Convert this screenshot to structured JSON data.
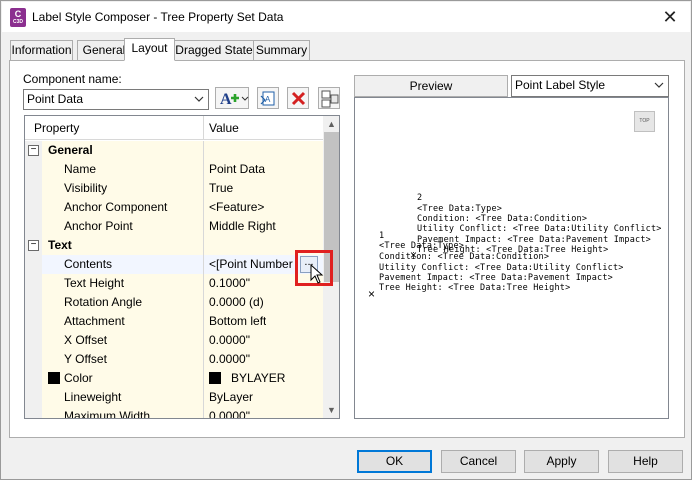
{
  "window": {
    "app_icon_text": "C",
    "app_icon_subtext": "C3D",
    "title": "Label Style Composer - Tree Property Set Data",
    "close_glyph": "✕"
  },
  "tabs": [
    {
      "label": "Information",
      "active": false
    },
    {
      "label": "General",
      "active": false
    },
    {
      "label": "Layout",
      "active": true
    },
    {
      "label": "Dragged State",
      "active": false
    },
    {
      "label": "Summary",
      "active": false
    }
  ],
  "component": {
    "label": "Component name:",
    "value": "Point Data"
  },
  "toolbar": {
    "add_icon": "add-component-icon",
    "copy_icon": "copy-component-icon",
    "delete_icon": "delete-component-icon",
    "order_icon": "component-draw-order-icon"
  },
  "grid": {
    "col_property": "Property",
    "col_value": "Value",
    "rows": [
      {
        "type": "category",
        "name": "General",
        "toggle": "−"
      },
      {
        "type": "prop",
        "name": "Name",
        "value": "Point Data"
      },
      {
        "type": "prop",
        "name": "Visibility",
        "value": "True"
      },
      {
        "type": "prop",
        "name": "Anchor Component",
        "value": "<Feature>"
      },
      {
        "type": "prop",
        "name": "Anchor Point",
        "value": "Middle Right"
      },
      {
        "type": "category",
        "name": "Text",
        "toggle": "−"
      },
      {
        "type": "prop",
        "name": "Contents",
        "value": "<[Point Number"
      },
      {
        "type": "prop",
        "name": "Text Height",
        "value": "0.1000\""
      },
      {
        "type": "prop",
        "name": "Rotation Angle",
        "value": "0.0000 (d)"
      },
      {
        "type": "prop",
        "name": "Attachment",
        "value": "Bottom left"
      },
      {
        "type": "prop",
        "name": "X Offset",
        "value": "0.0000\""
      },
      {
        "type": "prop",
        "name": "Y Offset",
        "value": "0.0000\""
      },
      {
        "type": "prop",
        "name": "Color",
        "value": "BYLAYER"
      },
      {
        "type": "prop",
        "name": "Lineweight",
        "value": "ByLayer"
      },
      {
        "type": "prop",
        "name": "Maximum Width",
        "value": "0.0000\""
      }
    ],
    "ellipsis_label": "..."
  },
  "preview": {
    "button_label": "Preview",
    "style_value": "Point Label Style",
    "top_icon_label": "TOP",
    "lines_upper": [
      "2",
      "<Tree Data:Type>",
      "Condition: <Tree Data:Condition>",
      "Utility Conflict: <Tree Data:Utility Conflict>",
      "Pavement Impact: <Tree Data:Pavement Impact>",
      "Tree Height: <Tree Data:Tree Height>"
    ],
    "lines_lower": [
      "1",
      "<Tree Data:Type>",
      "Condition: <Tree Data:Condition>",
      "Utility Conflict: <Tree Data:Utility Conflict>",
      "Pavement Impact: <Tree Data:Pavement Impact>",
      "Tree Height: <Tree Data:Tree Height>"
    ],
    "marker": "×"
  },
  "buttons": {
    "ok": "OK",
    "cancel": "Cancel",
    "apply": "Apply",
    "help": "Help"
  },
  "colors": {
    "accent": "#0078d7",
    "highlight": "#e02020",
    "category_bg": "#fffbe8"
  }
}
